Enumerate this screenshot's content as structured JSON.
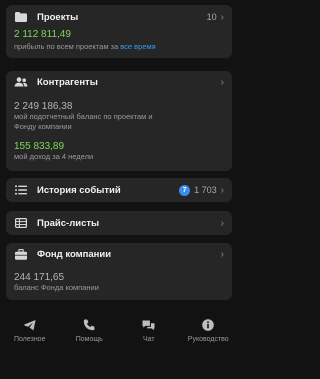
{
  "projects": {
    "title": "Проекты",
    "count": "10",
    "value": "2 112 811,49",
    "caption": "прибыль по всем проектам за",
    "period_link": "все время"
  },
  "counterparties": {
    "title": "Контрагенты",
    "balance_value": "2 249 186,38",
    "balance_caption_line1": "мой подотчетный баланс по проектам и",
    "balance_caption_line2": "Фонду компании",
    "income_value": "155 833,89",
    "income_caption": "мой доход за 4 недели"
  },
  "history": {
    "title": "История событий",
    "badge": "7",
    "count": "1 703"
  },
  "pricelists": {
    "title": "Прайс-листы"
  },
  "fund": {
    "title": "Фонд компании",
    "value": "244 171,65",
    "caption": "баланс Фонда компании"
  },
  "tabbar": {
    "items": [
      {
        "label": "Полезное",
        "icon": "paper-plane-icon"
      },
      {
        "label": "Помощь",
        "icon": "phone-icon"
      },
      {
        "label": "Чат",
        "icon": "chat-icon"
      },
      {
        "label": "Руководство",
        "icon": "info-icon"
      }
    ]
  },
  "colors": {
    "background": "#121212",
    "card": "#262626",
    "positive": "#7ed957",
    "link": "#3a9bf0",
    "badge": "#3a8ee8"
  }
}
